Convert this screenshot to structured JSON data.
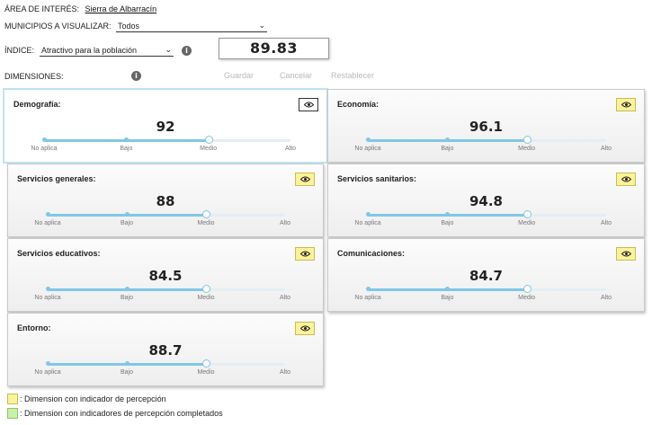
{
  "header": {
    "area_label": "ÁREA DE INTERÉS:",
    "area_value": "Sierra de Albarracín",
    "municipios_label": "MUNICIPIOS A VISUALIZAR:",
    "municipios_value": "Todos",
    "indice_label": "ÍNDICE:",
    "indice_value": "Atractivo para la población",
    "index_score": "89.83",
    "dimensiones_label": "DIMENSIONES:"
  },
  "actions": {
    "save": "Guardar",
    "cancel": "Cancelar",
    "reset": "Restablecer"
  },
  "slider_labels": [
    "No aplica",
    "Bajo",
    "Medio",
    "Alto"
  ],
  "colors": {
    "perception": "#fbf29b",
    "completed": "#c9f0a8",
    "slider": "#7fc7e6",
    "selected_border": "#bfe3f2"
  },
  "dimensions": [
    {
      "title": "Demografía:",
      "value": "92",
      "level": 2,
      "selected": true,
      "icon": "eye-icon"
    },
    {
      "title": "Economía:",
      "value": "96.1",
      "level": 2,
      "selected": false,
      "icon": "eye-icon"
    },
    {
      "title": "Servicios generales:",
      "value": "88",
      "level": 2,
      "selected": false,
      "icon": "eye-icon"
    },
    {
      "title": "Servicios sanitarios:",
      "value": "94.8",
      "level": 2,
      "selected": false,
      "icon": "eye-icon"
    },
    {
      "title": "Servicios educativos:",
      "value": "84.5",
      "level": 2,
      "selected": false,
      "icon": "eye-icon"
    },
    {
      "title": "Comunicaciones:",
      "value": "84.7",
      "level": 2,
      "selected": false,
      "icon": "eye-icon"
    },
    {
      "title": "Entorno:",
      "value": "88.7",
      "level": 2,
      "selected": false,
      "icon": "eye-icon"
    }
  ],
  "legend": {
    "perception": ": Dimension con indicador de percepción",
    "completed": ": Dimension con indicadores de percepción completados"
  }
}
